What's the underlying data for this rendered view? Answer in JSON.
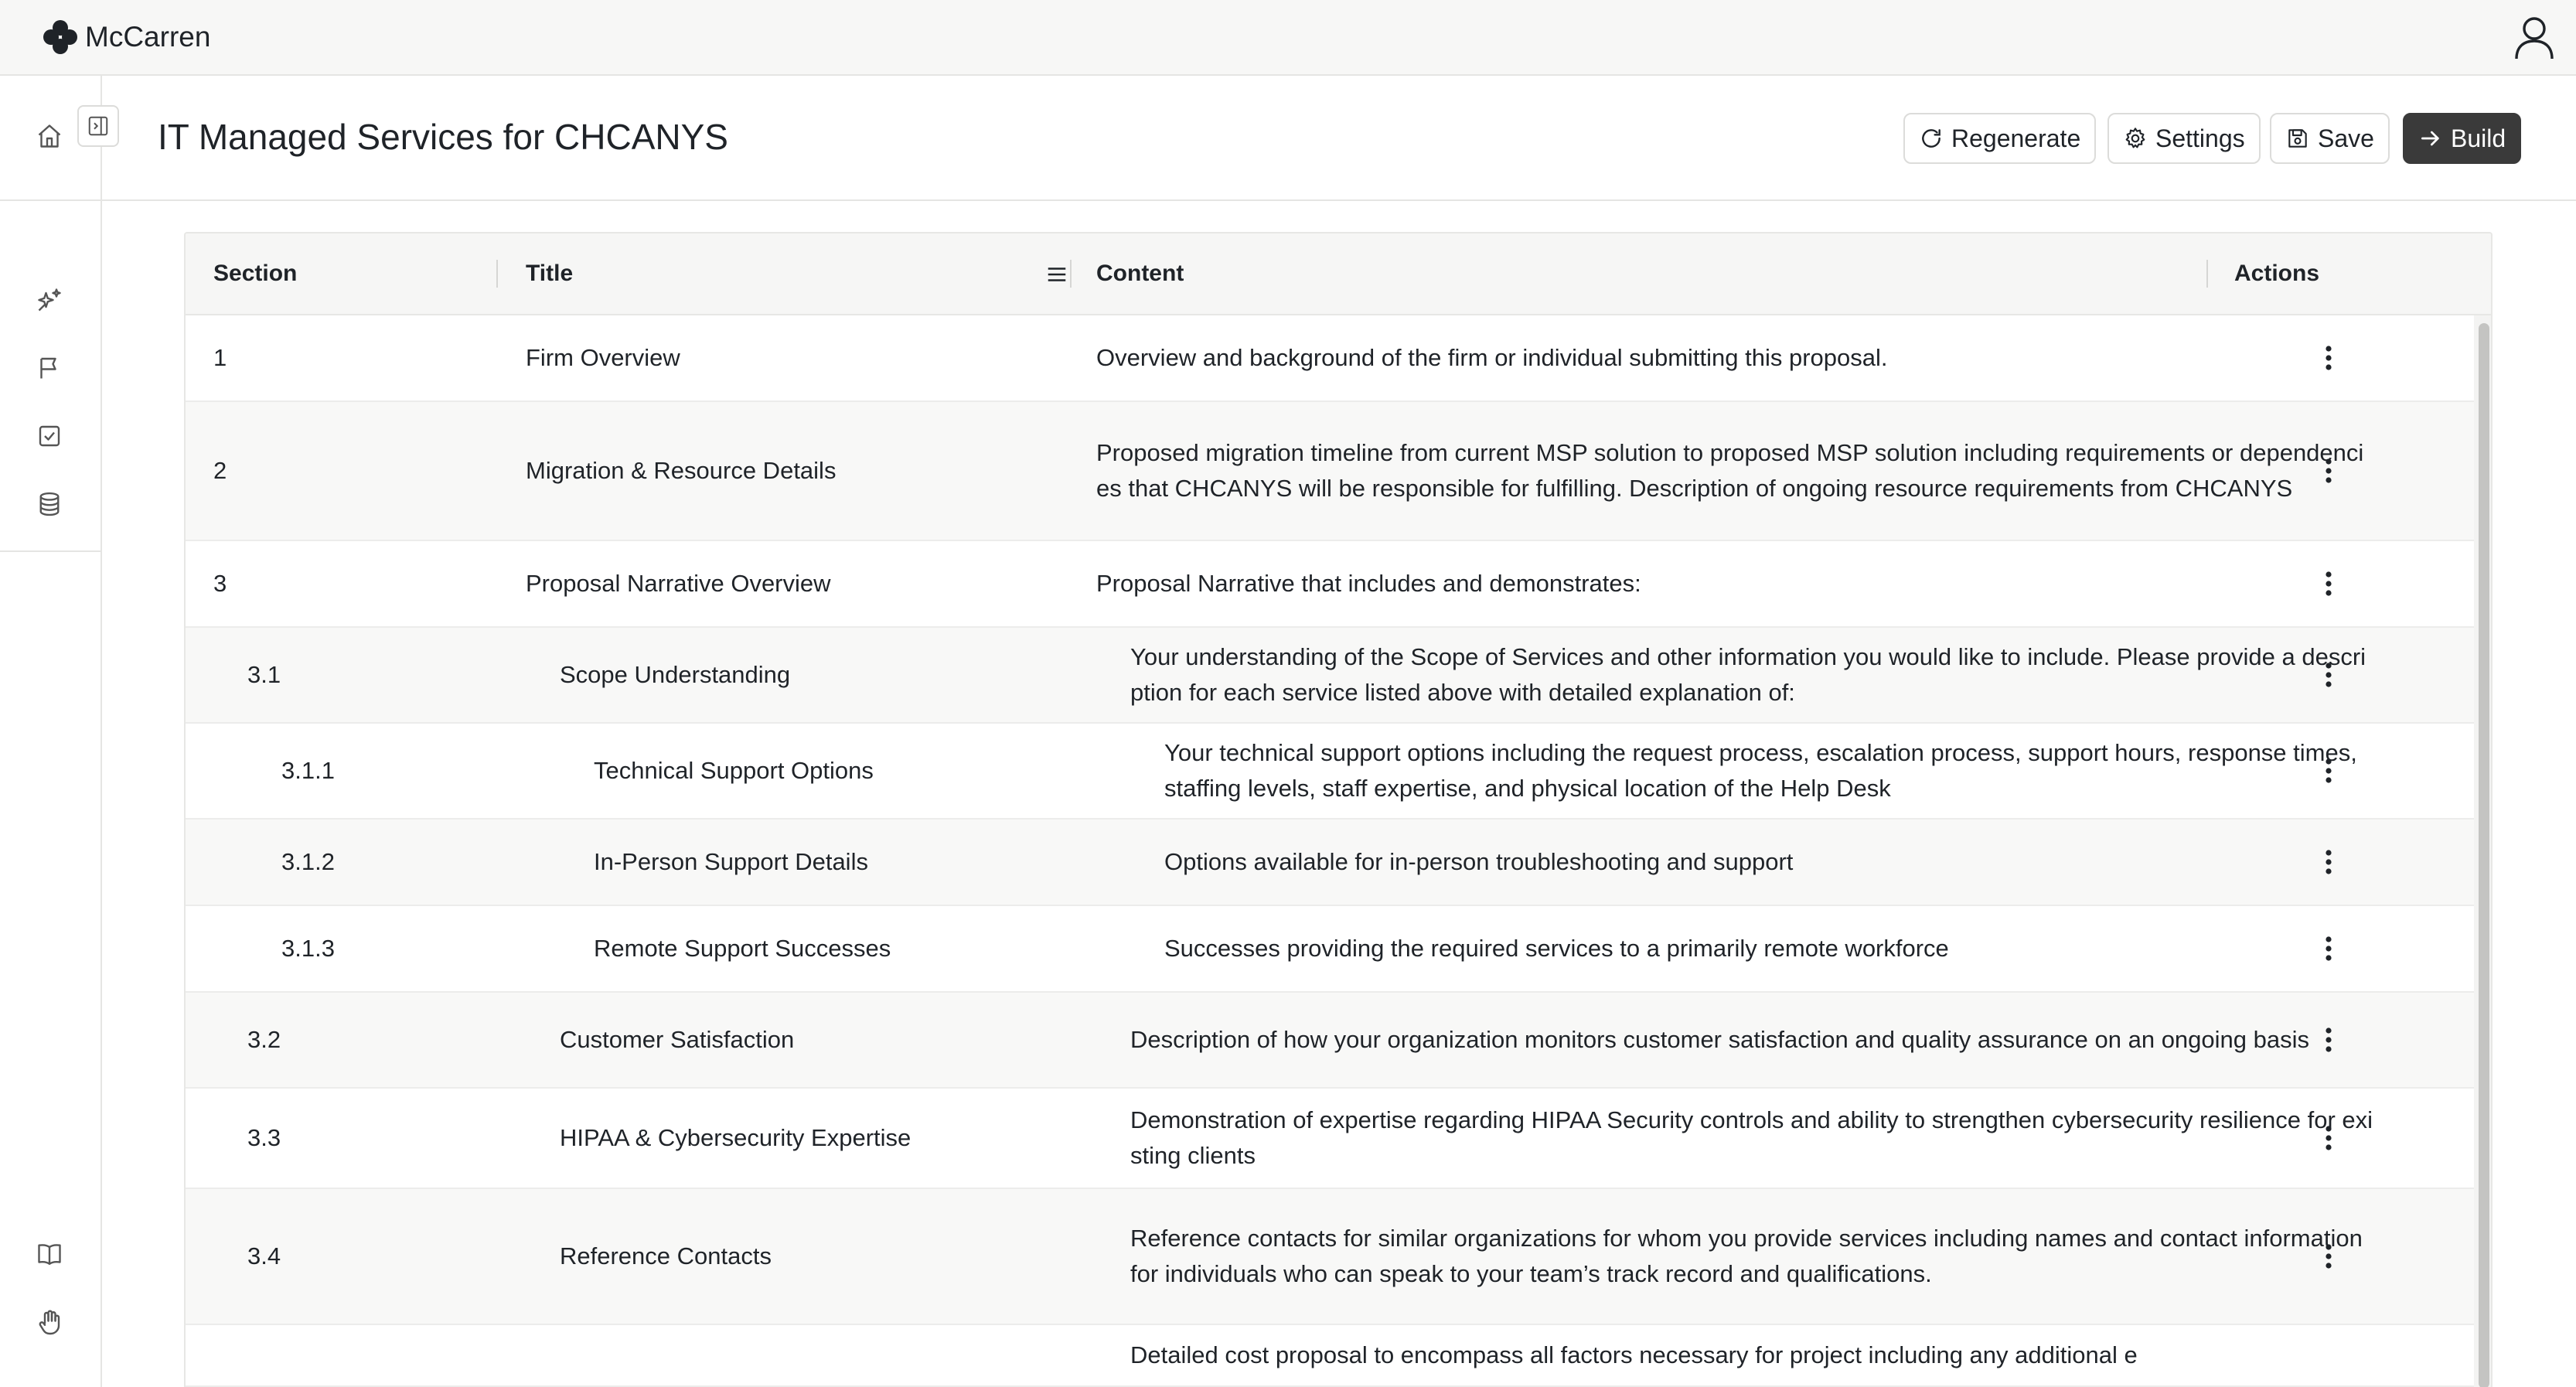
{
  "app": {
    "brand": "McCarren"
  },
  "header": {
    "title": "IT Managed Services for CHCANYS",
    "buttons": {
      "regenerate": "Regenerate",
      "settings": "Settings",
      "save": "Save",
      "build": "Build"
    }
  },
  "sidebar": {
    "icons": [
      "home-icon",
      "sparkles-icon",
      "flag-icon",
      "checkbox-icon",
      "database-icon",
      "book-icon",
      "hand-icon"
    ]
  },
  "table": {
    "columns": {
      "section": "Section",
      "title": "Title",
      "content": "Content",
      "actions": "Actions"
    },
    "rows": [
      {
        "section": "1",
        "title": "Firm Overview",
        "content": "Overview and background of the firm or individual submitting this proposal.",
        "level": 0
      },
      {
        "section": "2",
        "title": "Migration & Resource Details",
        "content": "Proposed migration timeline from current MSP solution to proposed MSP solution including requirements or dependencies that CHCANYS will be responsible for fulfilling. Description of ongoing resource requirements from CHCANYS",
        "level": 0
      },
      {
        "section": "3",
        "title": "Proposal Narrative Overview",
        "content": "Proposal Narrative that includes and demonstrates:",
        "level": 0
      },
      {
        "section": "3.1",
        "title": "Scope Understanding",
        "content": "Your understanding of the Scope of Services and other information you would like to include. Please provide a description for each service listed above with detailed explanation of:",
        "level": 1
      },
      {
        "section": "3.1.1",
        "title": "Technical Support Options",
        "content": "Your technical support options including the request process, escalation process, support hours, response times, staffing levels, staff expertise, and physical location of the Help Desk",
        "level": 2
      },
      {
        "section": "3.1.2",
        "title": "In-Person Support Details",
        "content": "Options available for in-person troubleshooting and support",
        "level": 2
      },
      {
        "section": "3.1.3",
        "title": "Remote Support Successes",
        "content": "Successes providing the required services to a primarily remote workforce",
        "level": 2
      },
      {
        "section": "3.2",
        "title": "Customer Satisfaction",
        "content": "Description of how your organization monitors customer satisfaction and quality assurance on an ongoing basis",
        "level": 1
      },
      {
        "section": "3.3",
        "title": "HIPAA & Cybersecurity Expertise",
        "content": "Demonstration of expertise regarding HIPAA Security controls and ability to strengthen cybersecurity resilience for existing clients",
        "level": 1
      },
      {
        "section": "3.4",
        "title": "Reference Contacts",
        "content": "Reference contacts for similar organizations for whom you provide services including names and contact information for individuals who can speak to your team’s track record and qualifications.",
        "level": 1
      },
      {
        "section": "",
        "title": "",
        "content": "Detailed cost proposal to encompass all factors necessary for project including any additional e",
        "level": 1
      }
    ]
  },
  "colors": {
    "accent_dark": "#3a3a3a",
    "header_bg": "#f7f7f6",
    "border": "#e5e5e3"
  }
}
